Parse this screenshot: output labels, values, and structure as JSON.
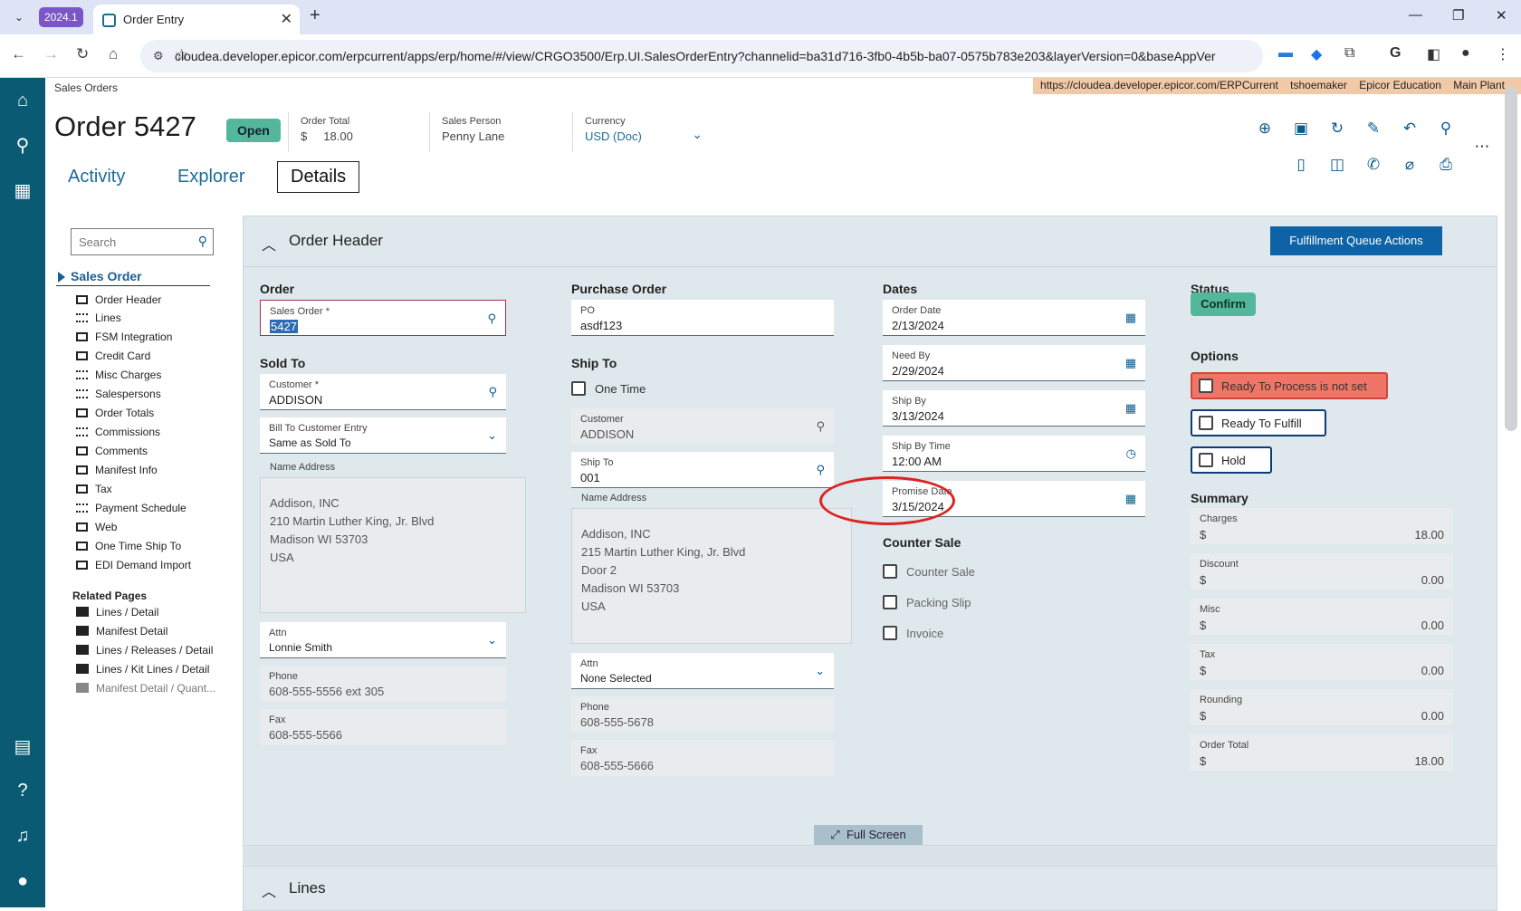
{
  "browser": {
    "version_badge": "2024.1",
    "tab_title": "Order Entry",
    "url": "cloudea.developer.epicor.com/erpcurrent/apps/erp/home/#/view/CRGO3500/Erp.UI.SalesOrderEntry?channelid=ba31d716-3fb0-4b5b-ba07-0575b783e203&layerVersion=0&baseAppVer..."
  },
  "app": {
    "breadcrumb": "Sales Orders",
    "env": {
      "url": "https://cloudea.developer.epicor.com/ERPCurrent",
      "user": "tshoemaker",
      "company": "Epicor Education",
      "plant": "Main Plant"
    },
    "title": "Order 5427",
    "status": "Open",
    "order_total": {
      "label": "Order Total",
      "currency": "$",
      "value": "18.00"
    },
    "sales_person": {
      "label": "Sales Person",
      "value": "Penny Lane"
    },
    "currency": {
      "label": "Currency",
      "value": "USD (Doc)"
    },
    "tabs": [
      "Activity",
      "Explorer",
      "Details"
    ]
  },
  "side": {
    "search_placeholder": "Search",
    "root": "Sales Order",
    "items": [
      "Order Header",
      "Lines",
      "FSM Integration",
      "Credit Card",
      "Misc Charges",
      "Salespersons",
      "Order Totals",
      "Commissions",
      "Comments",
      "Manifest Info",
      "Tax",
      "Payment Schedule",
      "Web",
      "One Time Ship To",
      "EDI Demand Import"
    ],
    "related_header": "Related Pages",
    "related": [
      "Lines / Detail",
      "Manifest Detail",
      "Lines / Releases / Detail",
      "Lines / Kit Lines / Detail",
      "Manifest Detail / Quant..."
    ]
  },
  "header_panel": {
    "title": "Order Header",
    "fq_button": "Fulfillment Queue Actions",
    "order": {
      "section": "Order",
      "sales_order_label": "Sales Order *",
      "sales_order_value": "5427",
      "sold_to_section": "Sold To",
      "customer_label": "Customer *",
      "customer_value": "ADDISON",
      "bill_to_label": "Bill To Customer Entry",
      "bill_to_value": "Same as Sold To",
      "name_address_label": "Name Address",
      "name_address": "Addison, INC\n210 Martin Luther King, Jr. Blvd\nMadison WI 53703\nUSA",
      "attn_label": "Attn",
      "attn_value": "Lonnie Smith",
      "phone_label": "Phone",
      "phone_value": "608-555-5556 ext 305",
      "fax_label": "Fax",
      "fax_value": "608-555-5566"
    },
    "purchase_order": {
      "section": "Purchase Order",
      "po_label": "PO",
      "po_value": "asdf123",
      "ship_to_section": "Ship To",
      "one_time": "One Time",
      "customer_label": "Customer",
      "customer_value": "ADDISON",
      "ship_to_label": "Ship To",
      "ship_to_value": "001",
      "name_address_label": "Name Address",
      "name_address": "Addison, INC\n215 Martin Luther King, Jr. Blvd\nDoor 2\nMadison WI 53703\nUSA",
      "attn_label": "Attn",
      "attn_value": "None Selected",
      "phone_label": "Phone",
      "phone_value": "608-555-5678",
      "fax_label": "Fax",
      "fax_value": "608-555-5666"
    },
    "dates": {
      "section": "Dates",
      "order_date_label": "Order Date",
      "order_date": "2/13/2024",
      "need_by_label": "Need By",
      "need_by": "2/29/2024",
      "ship_by_label": "Ship By",
      "ship_by": "3/13/2024",
      "ship_by_time_label": "Ship By Time",
      "ship_by_time": "12:00 AM",
      "promise_label": "Promise Date",
      "promise": "3/15/2024",
      "counter_section": "Counter Sale",
      "counter_sale": "Counter Sale",
      "packing_slip": "Packing Slip",
      "invoice": "Invoice"
    },
    "status": {
      "section": "Status",
      "confirm": "Confirm",
      "options_section": "Options",
      "ready_process": "Ready To Process is not set",
      "ready_fulfill": "Ready To Fulfill",
      "hold": "Hold",
      "summary_section": "Summary",
      "summary": [
        {
          "label": "Charges",
          "cur": "$",
          "value": "18.00"
        },
        {
          "label": "Discount",
          "cur": "$",
          "value": "0.00"
        },
        {
          "label": "Misc",
          "cur": "$",
          "value": "0.00"
        },
        {
          "label": "Tax",
          "cur": "$",
          "value": "0.00"
        },
        {
          "label": "Rounding",
          "cur": "$",
          "value": "0.00"
        },
        {
          "label": "Order Total",
          "cur": "$",
          "value": "18.00"
        }
      ]
    },
    "full_screen": "Full Screen"
  },
  "lines_panel": {
    "title": "Lines"
  },
  "colors": {
    "rail": "#0b5a74",
    "accent": "#0d63a6",
    "status_green": "#54b79b",
    "error": "#f07567",
    "annotation": "#dd2222"
  }
}
